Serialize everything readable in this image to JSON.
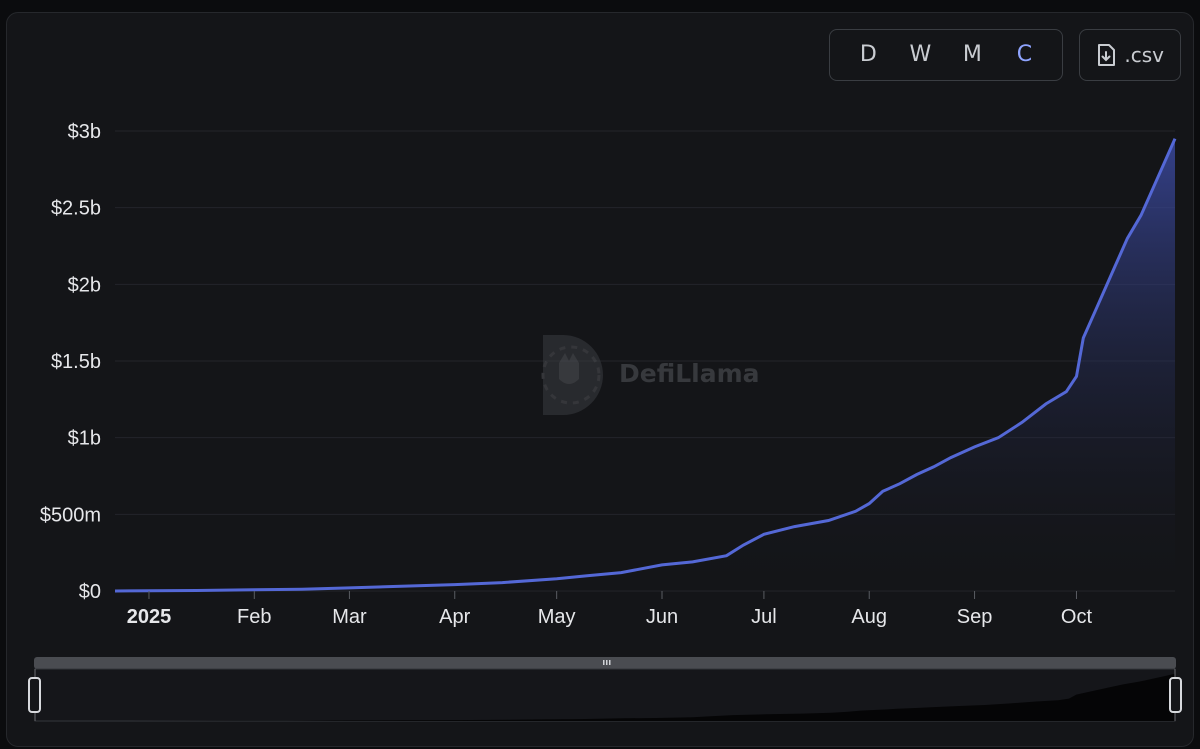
{
  "toolbar": {
    "granularity": [
      {
        "label": "D",
        "active": false
      },
      {
        "label": "W",
        "active": false
      },
      {
        "label": "M",
        "active": false
      },
      {
        "label": "C",
        "active": true
      }
    ],
    "csv_label": ".csv",
    "csv_icon": "file-download-icon"
  },
  "watermark": {
    "text": "DefiLlama",
    "icon": "llama-logo-icon"
  },
  "colors": {
    "line": "#5468d6",
    "area_top": "#3f4fb0",
    "grid": "#23252a",
    "axis_text": "#e6e7ea"
  },
  "chart_data": {
    "type": "area",
    "title": "",
    "xlabel": "",
    "ylabel": "",
    "grid": true,
    "legend": "none",
    "xlim": [
      "2024-12-22",
      "2025-10-30"
    ],
    "ylim": [
      0,
      3000000000
    ],
    "y_ticks": [
      {
        "value": 0,
        "label": "$0"
      },
      {
        "value": 500000000,
        "label": "$500m"
      },
      {
        "value": 1000000000,
        "label": "$1b"
      },
      {
        "value": 1500000000,
        "label": "$1.5b"
      },
      {
        "value": 2000000000,
        "label": "$2b"
      },
      {
        "value": 2500000000,
        "label": "$2.5b"
      },
      {
        "value": 3000000000,
        "label": "$3b"
      }
    ],
    "x_ticks": [
      {
        "date": "2025-01-01",
        "label": "2025",
        "bold": true
      },
      {
        "date": "2025-02-01",
        "label": "Feb"
      },
      {
        "date": "2025-03-01",
        "label": "Mar"
      },
      {
        "date": "2025-04-01",
        "label": "Apr"
      },
      {
        "date": "2025-05-01",
        "label": "May"
      },
      {
        "date": "2025-06-01",
        "label": "Jun"
      },
      {
        "date": "2025-07-01",
        "label": "Jul"
      },
      {
        "date": "2025-08-01",
        "label": "Aug"
      },
      {
        "date": "2025-09-01",
        "label": "Sep"
      },
      {
        "date": "2025-10-01",
        "label": "Oct"
      }
    ],
    "series": [
      {
        "points": [
          [
            "2024-12-22",
            0
          ],
          [
            "2025-01-15",
            3000000
          ],
          [
            "2025-02-01",
            8000000
          ],
          [
            "2025-02-15",
            12000000
          ],
          [
            "2025-03-01",
            20000000
          ],
          [
            "2025-03-15",
            30000000
          ],
          [
            "2025-04-01",
            42000000
          ],
          [
            "2025-04-15",
            55000000
          ],
          [
            "2025-05-01",
            80000000
          ],
          [
            "2025-05-10",
            100000000
          ],
          [
            "2025-05-20",
            120000000
          ],
          [
            "2025-06-01",
            170000000
          ],
          [
            "2025-06-10",
            190000000
          ],
          [
            "2025-06-20",
            230000000
          ],
          [
            "2025-06-25",
            300000000
          ],
          [
            "2025-07-01",
            370000000
          ],
          [
            "2025-07-10",
            420000000
          ],
          [
            "2025-07-20",
            460000000
          ],
          [
            "2025-07-28",
            520000000
          ],
          [
            "2025-08-01",
            570000000
          ],
          [
            "2025-08-05",
            650000000
          ],
          [
            "2025-08-10",
            700000000
          ],
          [
            "2025-08-15",
            760000000
          ],
          [
            "2025-08-20",
            810000000
          ],
          [
            "2025-08-25",
            870000000
          ],
          [
            "2025-09-01",
            940000000
          ],
          [
            "2025-09-08",
            1000000000
          ],
          [
            "2025-09-15",
            1100000000
          ],
          [
            "2025-09-22",
            1220000000
          ],
          [
            "2025-09-28",
            1300000000
          ],
          [
            "2025-10-01",
            1400000000
          ],
          [
            "2025-10-03",
            1650000000
          ],
          [
            "2025-10-07",
            1850000000
          ],
          [
            "2025-10-12",
            2100000000
          ],
          [
            "2025-10-16",
            2300000000
          ],
          [
            "2025-10-20",
            2450000000
          ],
          [
            "2025-10-24",
            2650000000
          ],
          [
            "2025-10-27",
            2800000000
          ],
          [
            "2025-10-30",
            2950000000
          ]
        ]
      }
    ]
  }
}
